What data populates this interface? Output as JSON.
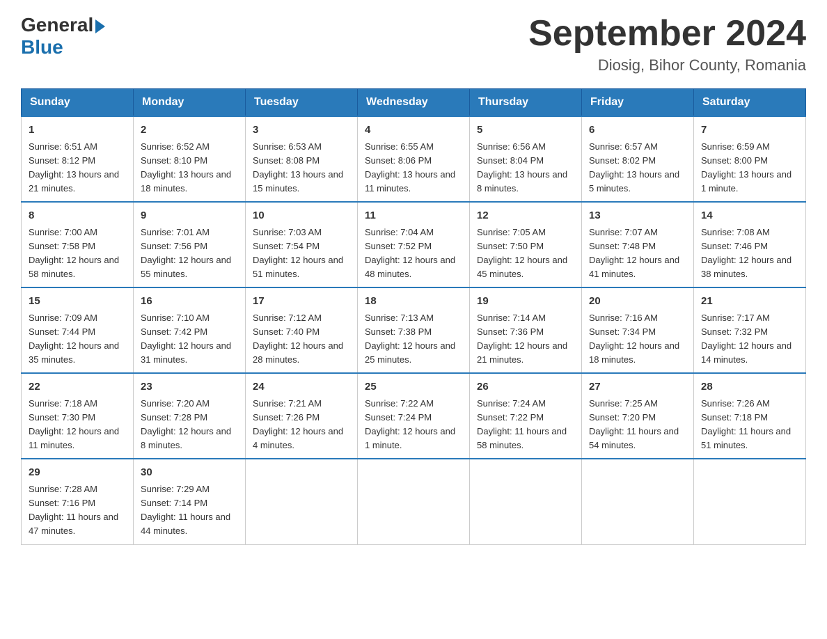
{
  "header": {
    "logo": {
      "general": "General",
      "blue": "Blue",
      "arrow": true
    },
    "title": "September 2024",
    "location": "Diosig, Bihor County, Romania"
  },
  "days_of_week": [
    "Sunday",
    "Monday",
    "Tuesday",
    "Wednesday",
    "Thursday",
    "Friday",
    "Saturday"
  ],
  "weeks": [
    [
      {
        "day": "1",
        "sunrise": "6:51 AM",
        "sunset": "8:12 PM",
        "daylight": "13 hours and 21 minutes."
      },
      {
        "day": "2",
        "sunrise": "6:52 AM",
        "sunset": "8:10 PM",
        "daylight": "13 hours and 18 minutes."
      },
      {
        "day": "3",
        "sunrise": "6:53 AM",
        "sunset": "8:08 PM",
        "daylight": "13 hours and 15 minutes."
      },
      {
        "day": "4",
        "sunrise": "6:55 AM",
        "sunset": "8:06 PM",
        "daylight": "13 hours and 11 minutes."
      },
      {
        "day": "5",
        "sunrise": "6:56 AM",
        "sunset": "8:04 PM",
        "daylight": "13 hours and 8 minutes."
      },
      {
        "day": "6",
        "sunrise": "6:57 AM",
        "sunset": "8:02 PM",
        "daylight": "13 hours and 5 minutes."
      },
      {
        "day": "7",
        "sunrise": "6:59 AM",
        "sunset": "8:00 PM",
        "daylight": "13 hours and 1 minute."
      }
    ],
    [
      {
        "day": "8",
        "sunrise": "7:00 AM",
        "sunset": "7:58 PM",
        "daylight": "12 hours and 58 minutes."
      },
      {
        "day": "9",
        "sunrise": "7:01 AM",
        "sunset": "7:56 PM",
        "daylight": "12 hours and 55 minutes."
      },
      {
        "day": "10",
        "sunrise": "7:03 AM",
        "sunset": "7:54 PM",
        "daylight": "12 hours and 51 minutes."
      },
      {
        "day": "11",
        "sunrise": "7:04 AM",
        "sunset": "7:52 PM",
        "daylight": "12 hours and 48 minutes."
      },
      {
        "day": "12",
        "sunrise": "7:05 AM",
        "sunset": "7:50 PM",
        "daylight": "12 hours and 45 minutes."
      },
      {
        "day": "13",
        "sunrise": "7:07 AM",
        "sunset": "7:48 PM",
        "daylight": "12 hours and 41 minutes."
      },
      {
        "day": "14",
        "sunrise": "7:08 AM",
        "sunset": "7:46 PM",
        "daylight": "12 hours and 38 minutes."
      }
    ],
    [
      {
        "day": "15",
        "sunrise": "7:09 AM",
        "sunset": "7:44 PM",
        "daylight": "12 hours and 35 minutes."
      },
      {
        "day": "16",
        "sunrise": "7:10 AM",
        "sunset": "7:42 PM",
        "daylight": "12 hours and 31 minutes."
      },
      {
        "day": "17",
        "sunrise": "7:12 AM",
        "sunset": "7:40 PM",
        "daylight": "12 hours and 28 minutes."
      },
      {
        "day": "18",
        "sunrise": "7:13 AM",
        "sunset": "7:38 PM",
        "daylight": "12 hours and 25 minutes."
      },
      {
        "day": "19",
        "sunrise": "7:14 AM",
        "sunset": "7:36 PM",
        "daylight": "12 hours and 21 minutes."
      },
      {
        "day": "20",
        "sunrise": "7:16 AM",
        "sunset": "7:34 PM",
        "daylight": "12 hours and 18 minutes."
      },
      {
        "day": "21",
        "sunrise": "7:17 AM",
        "sunset": "7:32 PM",
        "daylight": "12 hours and 14 minutes."
      }
    ],
    [
      {
        "day": "22",
        "sunrise": "7:18 AM",
        "sunset": "7:30 PM",
        "daylight": "12 hours and 11 minutes."
      },
      {
        "day": "23",
        "sunrise": "7:20 AM",
        "sunset": "7:28 PM",
        "daylight": "12 hours and 8 minutes."
      },
      {
        "day": "24",
        "sunrise": "7:21 AM",
        "sunset": "7:26 PM",
        "daylight": "12 hours and 4 minutes."
      },
      {
        "day": "25",
        "sunrise": "7:22 AM",
        "sunset": "7:24 PM",
        "daylight": "12 hours and 1 minute."
      },
      {
        "day": "26",
        "sunrise": "7:24 AM",
        "sunset": "7:22 PM",
        "daylight": "11 hours and 58 minutes."
      },
      {
        "day": "27",
        "sunrise": "7:25 AM",
        "sunset": "7:20 PM",
        "daylight": "11 hours and 54 minutes."
      },
      {
        "day": "28",
        "sunrise": "7:26 AM",
        "sunset": "7:18 PM",
        "daylight": "11 hours and 51 minutes."
      }
    ],
    [
      {
        "day": "29",
        "sunrise": "7:28 AM",
        "sunset": "7:16 PM",
        "daylight": "11 hours and 47 minutes."
      },
      {
        "day": "30",
        "sunrise": "7:29 AM",
        "sunset": "7:14 PM",
        "daylight": "11 hours and 44 minutes."
      },
      null,
      null,
      null,
      null,
      null
    ]
  ]
}
